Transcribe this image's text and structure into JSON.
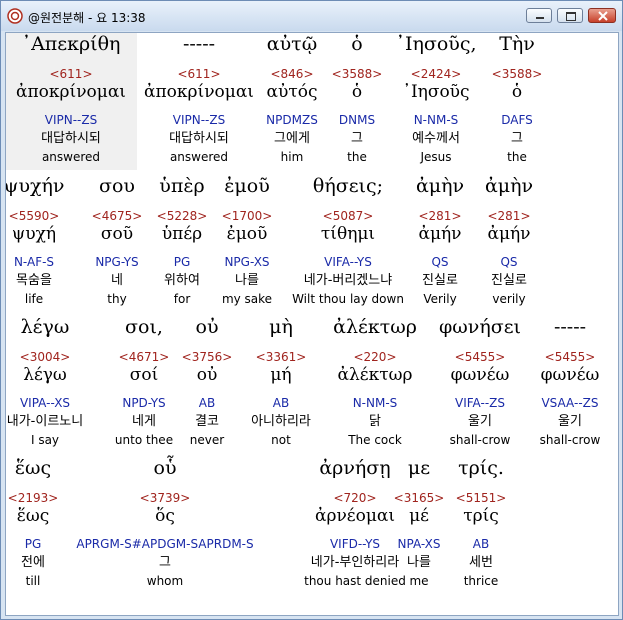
{
  "window": {
    "title": "@원전분해 - 요 13:38",
    "icon": "app-logo-icon",
    "buttons": [
      "minimize-icon",
      "maximize-icon",
      "close-icon"
    ]
  },
  "rows": [
    {
      "words": [
        {
          "greek": "᾿Απεκρίθη",
          "strongs": "<611>",
          "lemma": "ἀποκρίνομαι",
          "parse": "VIPN--ZS",
          "korean": "대답하시되",
          "english": "answered",
          "selected": true
        },
        {
          "greek": "-----",
          "strongs": "<611>",
          "lemma": "ἀποκρίνομαι",
          "parse": "VIPN--ZS",
          "korean": "대답하시되",
          "english": "answered"
        },
        {
          "greek": "αὐτῷ",
          "strongs": "<846>",
          "lemma": "αὐτός",
          "parse": "NPDMZS",
          "korean": "그에게",
          "english": "him"
        },
        {
          "greek": "ὁ",
          "strongs": "<3588>",
          "lemma": "ὁ",
          "parse": "DNMS",
          "korean": "그",
          "english": "the"
        },
        {
          "greek": "᾿Ιησοῦς,",
          "strongs": "<2424>",
          "lemma": "᾿Ιησοῦς",
          "parse": "N-NM-S",
          "korean": "예수께서",
          "english": "Jesus"
        },
        {
          "greek": "Τὴν",
          "strongs": "<3588>",
          "lemma": "ὁ",
          "parse": "DAFS",
          "korean": "그",
          "english": "the"
        }
      ]
    },
    {
      "words": [
        {
          "greek": "ψυχήν",
          "strongs": "<5590>",
          "lemma": "ψυχή",
          "parse": "N-AF-S",
          "korean": "목숨을",
          "english": "life"
        },
        {
          "greek": "σου",
          "strongs": "<4675>",
          "lemma": "σοῦ",
          "parse": "NPG-YS",
          "korean": "네",
          "english": "thy"
        },
        {
          "greek": "ὑπὲρ",
          "strongs": "<5228>",
          "lemma": "ὑπέρ",
          "parse": "PG",
          "korean": "위하여",
          "english": "for"
        },
        {
          "greek": "ἐμοῦ",
          "strongs": "<1700>",
          "lemma": "ἐμοῦ",
          "parse": "NPG-XS",
          "korean": "나를",
          "english": "my sake"
        },
        {
          "greek": "θήσεις;",
          "strongs": "<5087>",
          "lemma": "τίθημι",
          "parse": "VIFA--YS",
          "korean": "네가-버리겠느냐",
          "english": "Wilt thou lay down"
        },
        {
          "greek": "ἀμὴν",
          "strongs": "<281>",
          "lemma": "ἀμήν",
          "parse": "QS",
          "korean": "진실로",
          "english": "Verily"
        },
        {
          "greek": "ἀμὴν",
          "strongs": "<281>",
          "lemma": "ἀμήν",
          "parse": "QS",
          "korean": "진실로",
          "english": "verily"
        }
      ]
    },
    {
      "words": [
        {
          "greek": "λέγω",
          "strongs": "<3004>",
          "lemma": "λέγω",
          "parse": "VIPA--XS",
          "korean": "내가-이르노니",
          "english": "I say"
        },
        {
          "greek": "σοι,",
          "strongs": "<4671>",
          "lemma": "σοί",
          "parse": "NPD-YS",
          "korean": "네게",
          "english": "unto thee"
        },
        {
          "greek": "οὐ",
          "strongs": "<3756>",
          "lemma": "οὐ",
          "parse": "AB",
          "korean": "결코",
          "english": "never"
        },
        {
          "greek": "μὴ",
          "strongs": "<3361>",
          "lemma": "μή",
          "parse": "AB",
          "korean": "아니하리라",
          "english": "not"
        },
        {
          "greek": "ἀλέκτωρ",
          "strongs": "<220>",
          "lemma": "ἀλέκτωρ",
          "parse": "N-NM-S",
          "korean": "닭",
          "english": "The cock"
        },
        {
          "greek": "φωνήσει",
          "strongs": "<5455>",
          "lemma": "φωνέω",
          "parse": "VIFA--ZS",
          "korean": "울기",
          "english": "shall-crow"
        },
        {
          "greek": "-----",
          "strongs": "<5455>",
          "lemma": "φωνέω",
          "parse": "VSAA--ZS",
          "korean": "울기",
          "english": "shall-crow"
        }
      ]
    },
    {
      "words": [
        {
          "greek": "ἕως",
          "strongs": "<2193>",
          "lemma": "ἕως",
          "parse": "PG",
          "korean": "전에",
          "english": "till"
        },
        {
          "greek": "οὗ",
          "strongs": "<3739>",
          "lemma": "ὅς",
          "parse": "APRGM-S#APDGM-SAPRDM-S",
          "korean": "그",
          "english": "whom"
        },
        {
          "greek": "ἀρνήσῃ",
          "strongs": "<720>",
          "lemma": "ἀρνέομαι",
          "parse": "VIFD--YS",
          "korean": "네가-부인하리라",
          "english": "thou hast denied"
        },
        {
          "greek": "με",
          "strongs": "<3165>",
          "lemma": "μέ",
          "parse": "NPA-XS",
          "korean": "나를",
          "english": "me"
        },
        {
          "greek": "τρίς.",
          "strongs": "<5151>",
          "lemma": "τρίς",
          "parse": "AB",
          "korean": "세번",
          "english": "thrice"
        }
      ]
    }
  ]
}
